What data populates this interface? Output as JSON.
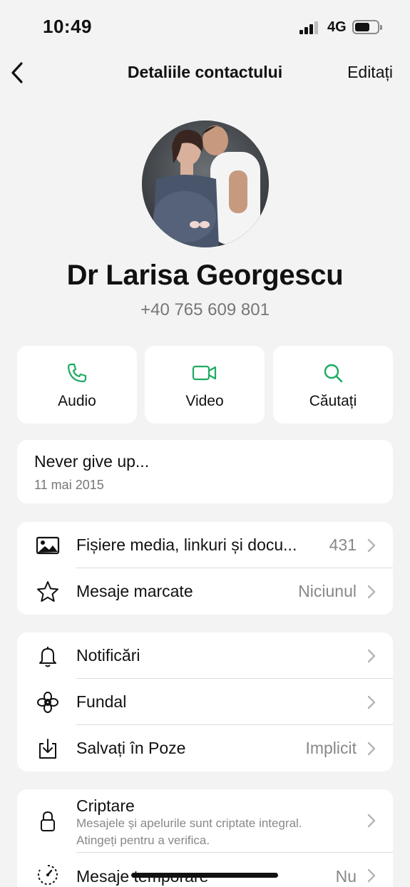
{
  "status_bar": {
    "time": "10:49",
    "network": "4G"
  },
  "nav": {
    "back_icon": "chevron-left-icon",
    "title": "Detaliile contactului",
    "edit_label": "Editați"
  },
  "contact": {
    "name": "Dr Larisa Georgescu",
    "phone": "+40 765 609 801"
  },
  "actions": [
    {
      "label": "Audio",
      "icon": "phone-icon"
    },
    {
      "label": "Video",
      "icon": "video-icon"
    },
    {
      "label": "Căutați",
      "icon": "search-icon"
    }
  ],
  "about": {
    "text": "Never give up...",
    "date": "11 mai 2015"
  },
  "media_section": [
    {
      "label": "Fișiere media, linkuri și docu...",
      "value": "431",
      "icon": "image-icon"
    },
    {
      "label": "Mesaje marcate",
      "value": "Niciunul",
      "icon": "star-icon"
    }
  ],
  "settings_section": [
    {
      "label": "Notificări",
      "value": "",
      "icon": "bell-icon"
    },
    {
      "label": "Fundal",
      "value": "",
      "icon": "flower-icon"
    },
    {
      "label": "Salvați în Poze",
      "value": "Implicit",
      "icon": "download-icon"
    }
  ],
  "privacy_section": {
    "encryption": {
      "label": "Criptare",
      "line1": "Mesajele și apelurile sunt criptate integral.",
      "line2": "Atingeți pentru a verifica.",
      "icon": "lock-icon"
    },
    "disappearing": {
      "label": "Mesaje temporare",
      "value": "Nu",
      "icon": "timer-icon"
    }
  },
  "colors": {
    "accent": "#1daa61",
    "background": "#f3f3f3",
    "card": "#ffffff"
  }
}
